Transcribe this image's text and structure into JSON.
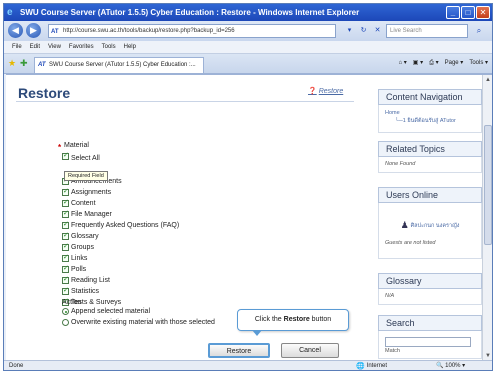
{
  "window": {
    "title": "SWU Course Server (ATutor 1.5.5) Cyber Education : Restore - Windows Internet Explorer",
    "buttons": [
      "_",
      "□",
      "✕"
    ]
  },
  "address_bar": {
    "site_label": "AT",
    "url": "http://course.swu.ac.th/tools/backup/restore.php?backup_id=256",
    "search_placeholder": "Live Search"
  },
  "menu": [
    "File",
    "Edit",
    "View",
    "Favorites",
    "Tools",
    "Help"
  ],
  "tab": {
    "icon_label": "AT",
    "title": "SWU Course Server (ATutor 1.5.5) Cyber Education :..."
  },
  "command_bar": {
    "page_label": "Page ▾",
    "tools_label": "Tools ▾"
  },
  "page": {
    "title": "Restore",
    "help_link": "Restore"
  },
  "form": {
    "material_label": "Material",
    "select_all_label": "Select All",
    "tooltip": "Required Field",
    "items": [
      "Announcements",
      "Assignments",
      "Content",
      "File Manager",
      "Frequently Asked Questions (FAQ)",
      "Glossary",
      "Groups",
      "Links",
      "Polls",
      "Reading List",
      "Statistics",
      "Tests & Surveys"
    ],
    "action_label": "Action",
    "radio_append": "Append selected material",
    "radio_overwrite": "Overwrite existing material with those selected",
    "restore_button": "Restore",
    "cancel_button": "Cancel"
  },
  "callout": {
    "prefix": "Click the ",
    "bold": "Restore",
    "suffix": " button"
  },
  "sidebar": {
    "content_nav": {
      "title": "Content Navigation",
      "home": "Home",
      "child": "1 ยินดีต้อนรับสู่ ATutor"
    },
    "related": {
      "title": "Related Topics",
      "body": "None Found"
    },
    "users_online": {
      "title": "Users Online",
      "user": "ศิลปะกนก นงคราญัง",
      "note": "Guests are not listed"
    },
    "glossary": {
      "title": "Glossary",
      "body": "N/A"
    },
    "search": {
      "title": "Search",
      "hint": "Match"
    }
  },
  "status_bar": {
    "left": "Done",
    "zone": "Internet",
    "zoom": "100%"
  },
  "colors": {
    "titlebar": "#1c47b8",
    "page_title": "#2d4a7a",
    "callout_border": "#5a9bd5"
  }
}
